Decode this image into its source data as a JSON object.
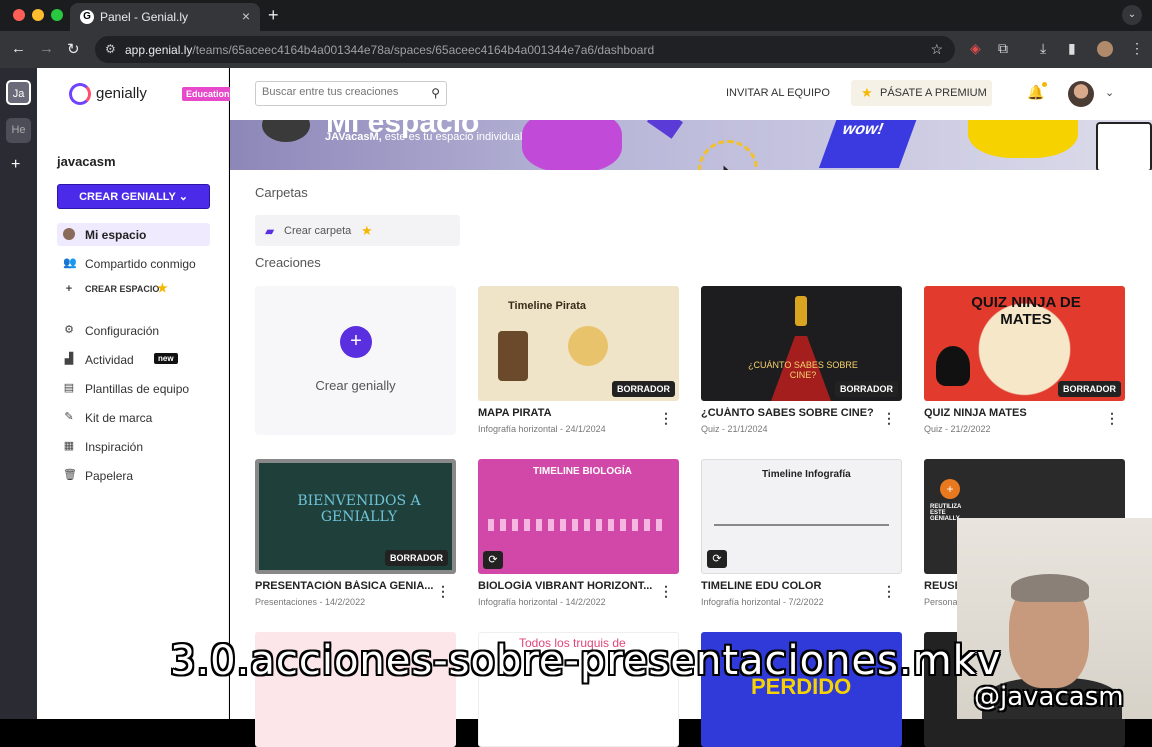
{
  "browser": {
    "tab_title": "Panel - Genial.ly",
    "tab_close": "×",
    "new_tab": "+",
    "url_host": "app.genial.ly",
    "url_path": "/teams/65aceec4164b4a001344e78a/spaces/65aceec4164b4a001344e7a6/dashboard",
    "extension_icons": [
      "star-icon",
      "pocket-icon",
      "puzzle-icon",
      "download-icon",
      "sidepanel-icon",
      "profile-icon",
      "kebab-icon"
    ],
    "dot_colors": [
      "#ff5f57",
      "#febc2e",
      "#28c840"
    ]
  },
  "rail": {
    "workspaces": [
      "Ja",
      "He"
    ],
    "add": "+"
  },
  "brand": {
    "name": "genially",
    "badge": "Education",
    "accent": "#4b2aea"
  },
  "sidebar": {
    "username": "javacasm",
    "create_label": "CREAR GENIALLY",
    "items": [
      {
        "label": "Mi espacio",
        "icon": "user-icon"
      },
      {
        "label": "Compartido conmigo",
        "icon": "users-icon"
      },
      {
        "label": "CREAR ESPACIO",
        "icon": "plus-icon"
      },
      {
        "label": "Configuración",
        "icon": "gear-icon"
      },
      {
        "label": "Actividad",
        "icon": "bar-chart-icon",
        "badge": "new"
      },
      {
        "label": "Plantillas de equipo",
        "icon": "template-icon"
      },
      {
        "label": "Kit de marca",
        "icon": "brand-kit-icon"
      },
      {
        "label": "Inspiración",
        "icon": "inspiration-icon"
      },
      {
        "label": "Papelera",
        "icon": "trash-icon"
      }
    ]
  },
  "topbar": {
    "search_placeholder": "Buscar entre tus creaciones",
    "invite_label": "INVITAR AL EQUIPO",
    "premium_label": "PÁSATE A PREMIUM"
  },
  "banner": {
    "title": "Mi espacio",
    "subtitle_user": "JAVacasM,",
    "subtitle_rest": " este es tu espacio individual",
    "wow": "wow!"
  },
  "main": {
    "folders_heading": "Carpetas",
    "create_folder": "Crear carpeta",
    "creations_heading": "Creaciones",
    "create_genially": "Crear genially"
  },
  "cards": [
    {
      "title": "MAPA PIRATA",
      "meta": "Infografía horizontal - 24/1/2024",
      "tag": "BORRADOR",
      "thumb_text": "Timeline Pirata"
    },
    {
      "title": "¿CUÁNTO SABES SOBRE CINE?",
      "meta": "Quiz - 21/1/2024",
      "tag": "BORRADOR",
      "thumb_text": "¿CUÁNTO SABES SOBRE CINE?"
    },
    {
      "title": "QUIZ NINJA MATES",
      "meta": "Quiz - 21/2/2022",
      "tag": "BORRADOR",
      "thumb_text": "QUIZ NINJA DE MATES"
    },
    {
      "title": "PRESENTACIÓN BÁSICA GENIA...",
      "meta": "Presentaciones - 14/2/2022",
      "tag": "BORRADOR",
      "thumb_text": "BIENVENIDOS A GENIALLY"
    },
    {
      "title": "BIOLOGÍA VIBRANT HORIZONT...",
      "meta": "Infografía horizontal - 14/2/2022",
      "tag": "",
      "thumb_text": "TIMELINE BIOLOGÍA"
    },
    {
      "title": "TIMELINE EDU COLOR",
      "meta": "Infografía horizontal - 7/2/2022",
      "tag": "",
      "thumb_text": "Timeline Infografía"
    },
    {
      "title": "REUSE",
      "meta": "Persona",
      "tag": "",
      "thumb_text": "REUTILIZA ESTE GENIALLY"
    },
    {
      "title": "",
      "meta": "",
      "tag": "",
      "thumb_text": ""
    },
    {
      "title": "",
      "meta": "",
      "tag": "",
      "thumb_text": "Todos los truquis de"
    },
    {
      "title": "",
      "meta": "",
      "tag": "",
      "thumb_text": "PERDIDO"
    },
    {
      "title": "",
      "meta": "",
      "tag": "",
      "thumb_text": ""
    }
  ],
  "overlay": {
    "filename": "3.0.acciones-sobre-presentaciones.mkv",
    "handle": "@javacasm"
  }
}
